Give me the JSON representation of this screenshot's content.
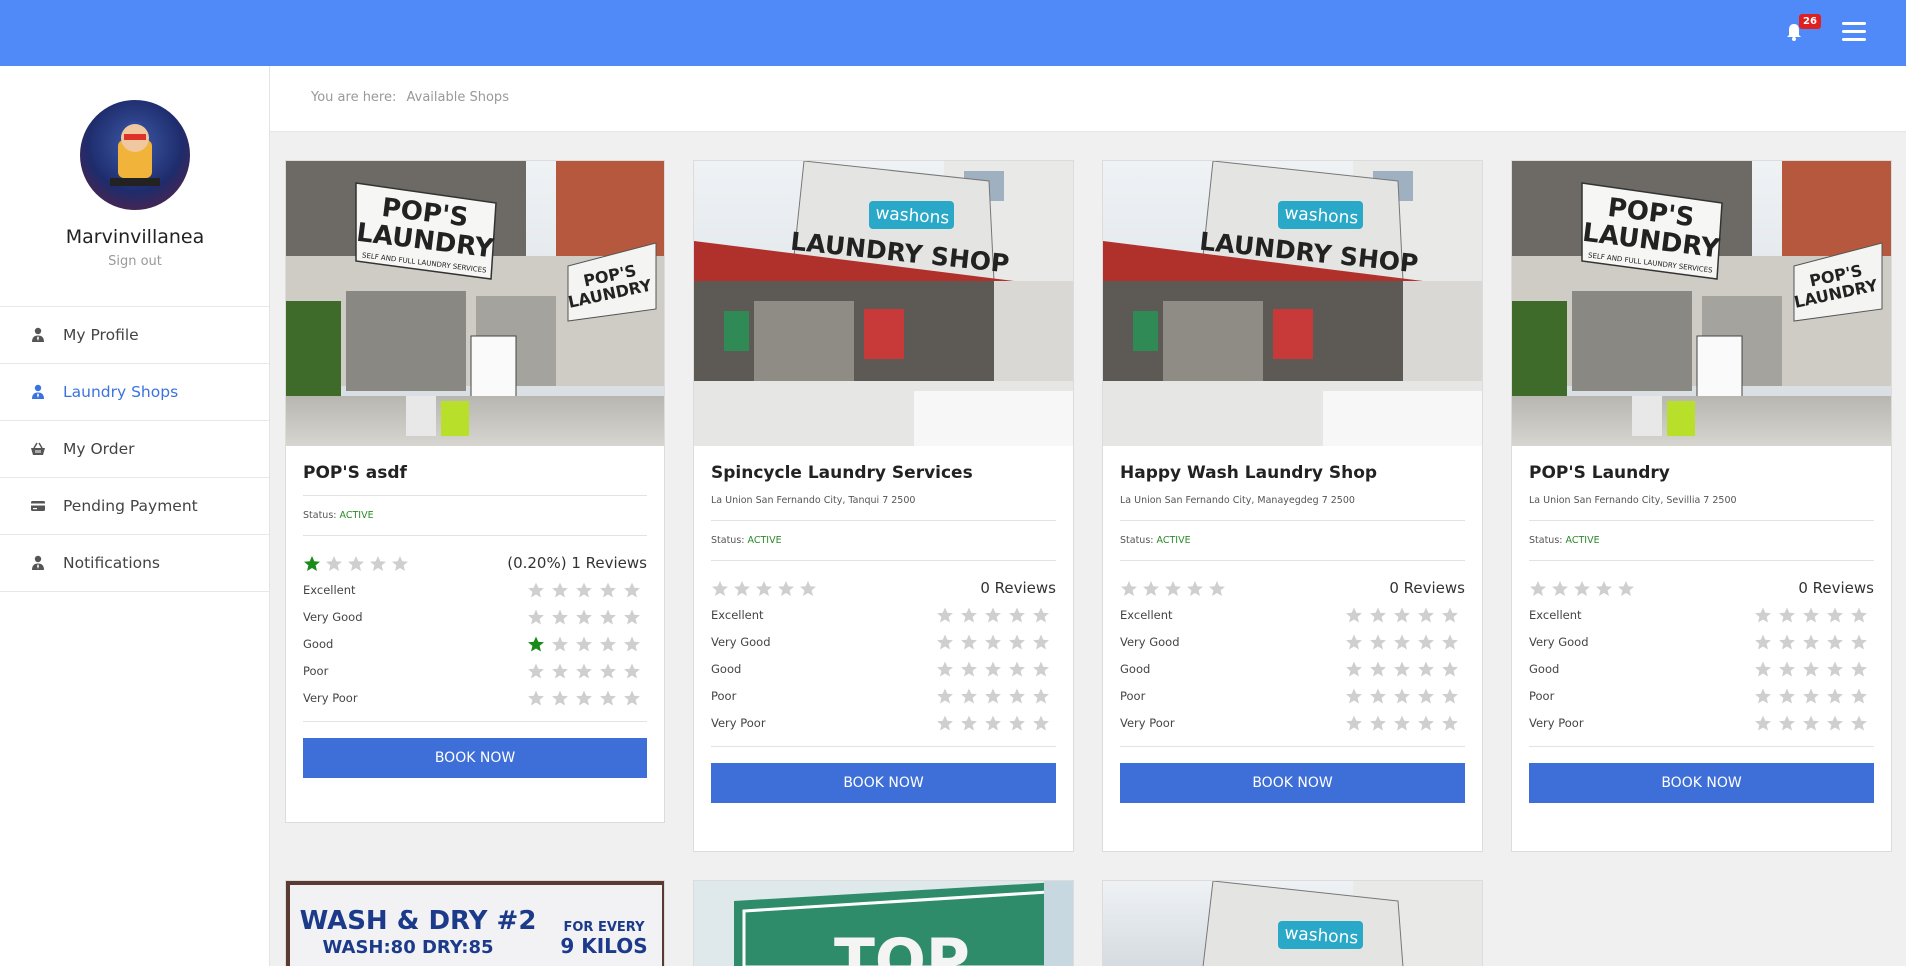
{
  "topbar": {
    "notification_count": "26",
    "accent": "#4f8af8"
  },
  "sidebar": {
    "user_name": "Marvinvillanea",
    "signout_label": "Sign out",
    "items": [
      {
        "label": "My Profile",
        "icon": "user-tie-icon"
      },
      {
        "label": "Laundry Shops",
        "icon": "user-tie-icon"
      },
      {
        "label": "My Order",
        "icon": "shopping-basket-icon"
      },
      {
        "label": "Pending Payment",
        "icon": "credit-card-icon"
      },
      {
        "label": "Notifications",
        "icon": "user-tie-icon"
      }
    ]
  },
  "breadcrumb": {
    "prefix": "You are here:",
    "current": "Available Shops"
  },
  "rating_labels": [
    "Excellent",
    "Very Good",
    "Good",
    "Poor",
    "Very Poor"
  ],
  "status_label": "Status:",
  "book_label": "BOOK NOW",
  "shops": [
    {
      "name": "POP'S asdf",
      "address": "",
      "status": "ACTIVE",
      "overall_stars": 1,
      "reviews": "(0.20%) 1 Reviews",
      "breakdown": [
        0,
        0,
        1,
        0,
        0
      ]
    },
    {
      "name": "Spincycle Laundry Services",
      "address": "La Union San Fernando City, Tanqui 7 2500",
      "status": "ACTIVE",
      "overall_stars": 0,
      "reviews": "0 Reviews",
      "breakdown": [
        0,
        0,
        0,
        0,
        0
      ]
    },
    {
      "name": "Happy Wash Laundry Shop",
      "address": "La Union San Fernando City, Manayegdeg 7 2500",
      "status": "ACTIVE",
      "overall_stars": 0,
      "reviews": "0 Reviews",
      "breakdown": [
        0,
        0,
        0,
        0,
        0
      ]
    },
    {
      "name": "POP'S Laundry",
      "address": "La Union San Fernando City, Sevillia 7 2500",
      "status": "ACTIVE",
      "overall_stars": 0,
      "reviews": "0 Reviews",
      "breakdown": [
        0,
        0,
        0,
        0,
        0
      ]
    }
  ],
  "photos": {
    "pops_sign": [
      "POP'S",
      "LAUNDRY",
      "SELF AND FULL LAUNDRY SERVICES"
    ],
    "pops_side": [
      "POP'S",
      "LAUNDRY"
    ],
    "washons_sign": [
      "washons",
      "LAUNDRY SHOP"
    ],
    "wash_dry_sign": [
      "WASH & DRY #2",
      "WASH:80  DRY:85",
      "FOR EVERY",
      "9 KILOS"
    ],
    "partial_sign": "TOP"
  }
}
